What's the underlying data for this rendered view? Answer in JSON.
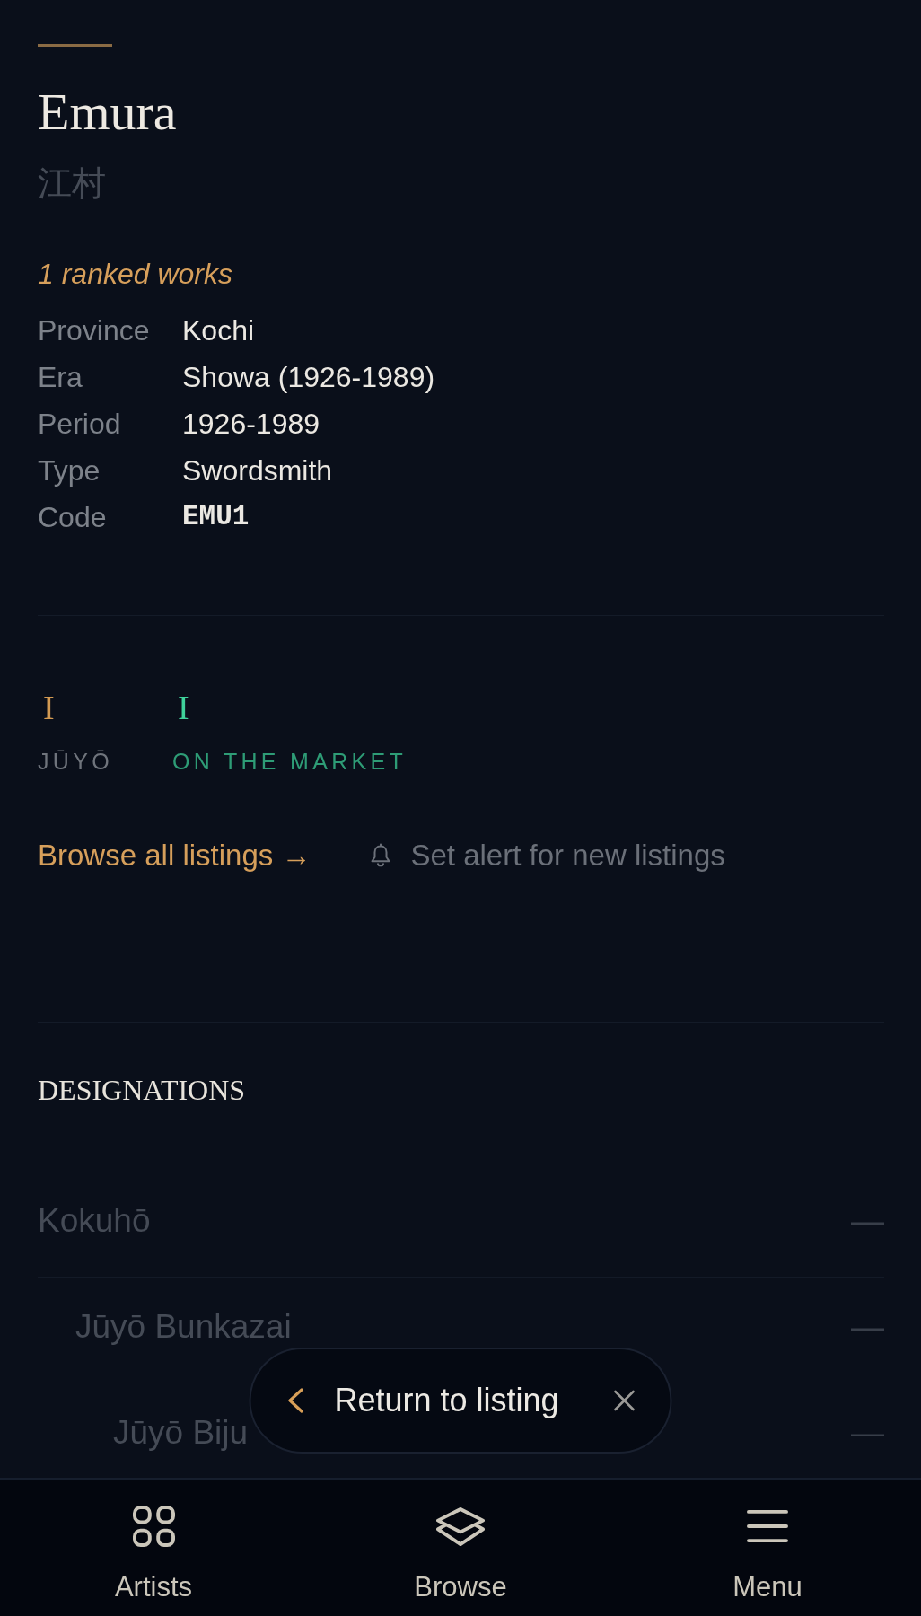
{
  "header": {
    "name": "Emura",
    "name_native": "江村",
    "ranked_works": "1 ranked works"
  },
  "details": [
    {
      "label": "Province",
      "value": "Kochi",
      "kind": "text"
    },
    {
      "label": "Era",
      "value": "Showa (1926-1989)",
      "kind": "text"
    },
    {
      "label": "Period",
      "value": "1926-1989",
      "kind": "text"
    },
    {
      "label": "Type",
      "value": "Swordsmith",
      "kind": "text"
    },
    {
      "label": "Code",
      "value": "EMU1",
      "kind": "code"
    }
  ],
  "stats": [
    {
      "value": "I",
      "label": "JŪYŌ",
      "kind": "rank"
    },
    {
      "value": "I",
      "label": "ON THE MARKET",
      "kind": "market"
    }
  ],
  "links": [
    {
      "label": "Browse all listings →",
      "kind": "browse"
    },
    {
      "label": "Set alert for new listings",
      "kind": "alert"
    }
  ],
  "designations": {
    "title": "DESIGNATIONS",
    "items": [
      {
        "name": "Kokuhō",
        "value": "—",
        "children": [
          {
            "name": "Jūyō Bunkazai",
            "value": "—",
            "children": [
              {
                "name": "Jūyō Biju",
                "value": "—"
              }
            ]
          }
        ]
      }
    ]
  },
  "return_toast": {
    "label": "Return to listing"
  },
  "bottom_nav": [
    {
      "label": "Artists",
      "selected": false
    },
    {
      "label": "Browse",
      "selected": false
    },
    {
      "label": "Menu",
      "selected": false
    }
  ]
}
